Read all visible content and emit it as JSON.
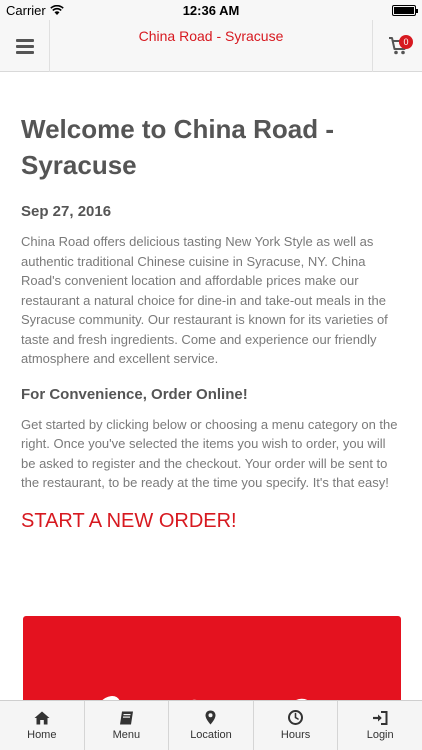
{
  "status_bar": {
    "carrier": "Carrier",
    "time": "12:36 AM"
  },
  "header": {
    "title": "China Road - Syracuse",
    "cart_count": "0"
  },
  "main": {
    "title": "Welcome to China Road - Syracuse",
    "date": "Sep 27, 2016",
    "intro": "China Road offers delicious tasting New York Style as well as authentic traditional Chinese cuisine in Syracuse, NY. China Road's convenient location and affordable prices make our restaurant a natural choice for dine-in and take-out meals in the Syracuse community. Our restaurant is known for its varieties of taste and fresh ingredients. Come and experience our friendly atmosphere and excellent service.",
    "subheading": "For Convenience, Order Online!",
    "instructions": "Get started by clicking below or choosing a menu category on the right. Once you've selected the items you wish to order, you will be asked to register and the checkout. Your order will be sent to the restaurant, to be ready at the time you specify. It's that easy!",
    "cta": "START A NEW ORDER!"
  },
  "tabs": [
    {
      "label": "Home",
      "icon": "home-icon"
    },
    {
      "label": "Menu",
      "icon": "book-icon"
    },
    {
      "label": "Location",
      "icon": "map-marker-icon"
    },
    {
      "label": "Hours",
      "icon": "clock-icon"
    },
    {
      "label": "Login",
      "icon": "login-icon"
    }
  ],
  "colors": {
    "accent": "#d71920",
    "banner": "#e4121f",
    "text": "#555555",
    "muted": "#7a7a7a"
  }
}
